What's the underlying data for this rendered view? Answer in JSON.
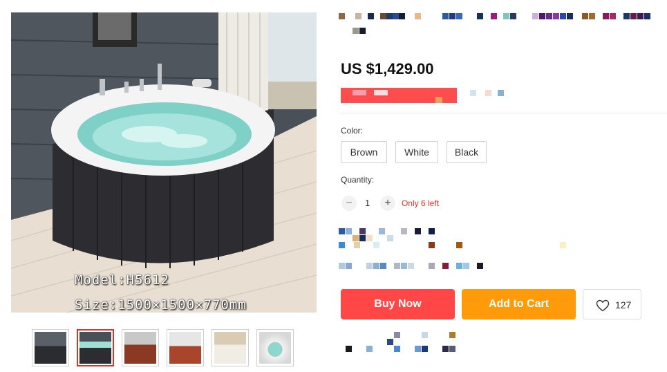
{
  "product": {
    "image_caption_model": "Model:H5612",
    "image_caption_size": "Size:1500×1500×770mm",
    "price": "US $1,429.00"
  },
  "options": {
    "color_label": "Color:",
    "colors": [
      "Brown",
      "White",
      "Black"
    ],
    "quantity_label": "Quantity:",
    "quantity_minus": "−",
    "quantity_value": "1",
    "quantity_plus": "+",
    "stock_note": "Only 6 left"
  },
  "actions": {
    "buy_now": "Buy Now",
    "add_to_cart": "Add to Cart",
    "wishlist_count": "127"
  },
  "thumbnails": {
    "count": 6,
    "active_index": 1
  },
  "colors": {
    "buy_now": "#ff4747",
    "add_to_cart": "#ff9a0a",
    "stock_warning": "#e0302a"
  },
  "icons": [
    "heart-icon"
  ]
}
